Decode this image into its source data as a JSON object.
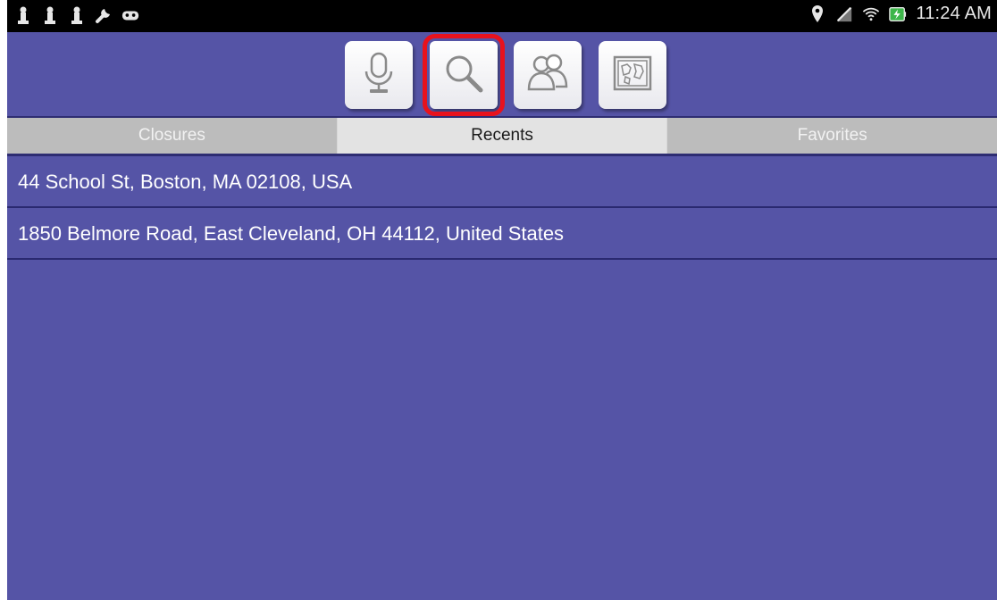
{
  "status_bar": {
    "left_icons": [
      "chess-pawn-icon",
      "chess-pawn-icon",
      "chess-pawn-icon",
      "wrench-icon",
      "gamepad-icon"
    ],
    "right_icons": [
      "location-pin-icon",
      "no-signal-icon",
      "wifi-icon",
      "battery-charging-icon"
    ],
    "time": "11:24 AM"
  },
  "toolbar": {
    "buttons": [
      {
        "name": "microphone",
        "icon": "microphone-icon",
        "active": false
      },
      {
        "name": "search",
        "icon": "magnifier-icon",
        "active": true
      },
      {
        "name": "people",
        "icon": "people-icon",
        "active": false
      },
      {
        "name": "map",
        "icon": "map-icon",
        "active": false
      }
    ]
  },
  "tabs": [
    {
      "label": "Closures",
      "active": false
    },
    {
      "label": "Recents",
      "active": true
    },
    {
      "label": "Favorites",
      "active": false
    }
  ],
  "recents": [
    "44 School St, Boston, MA 02108, USA",
    "1850 Belmore Road, East Cleveland, OH 44112, United States"
  ],
  "colors": {
    "background": "#5554a6",
    "active_outline": "#e8121d",
    "tab_active": "#e3e3e3",
    "tab_inactive": "#bcbcbc"
  }
}
